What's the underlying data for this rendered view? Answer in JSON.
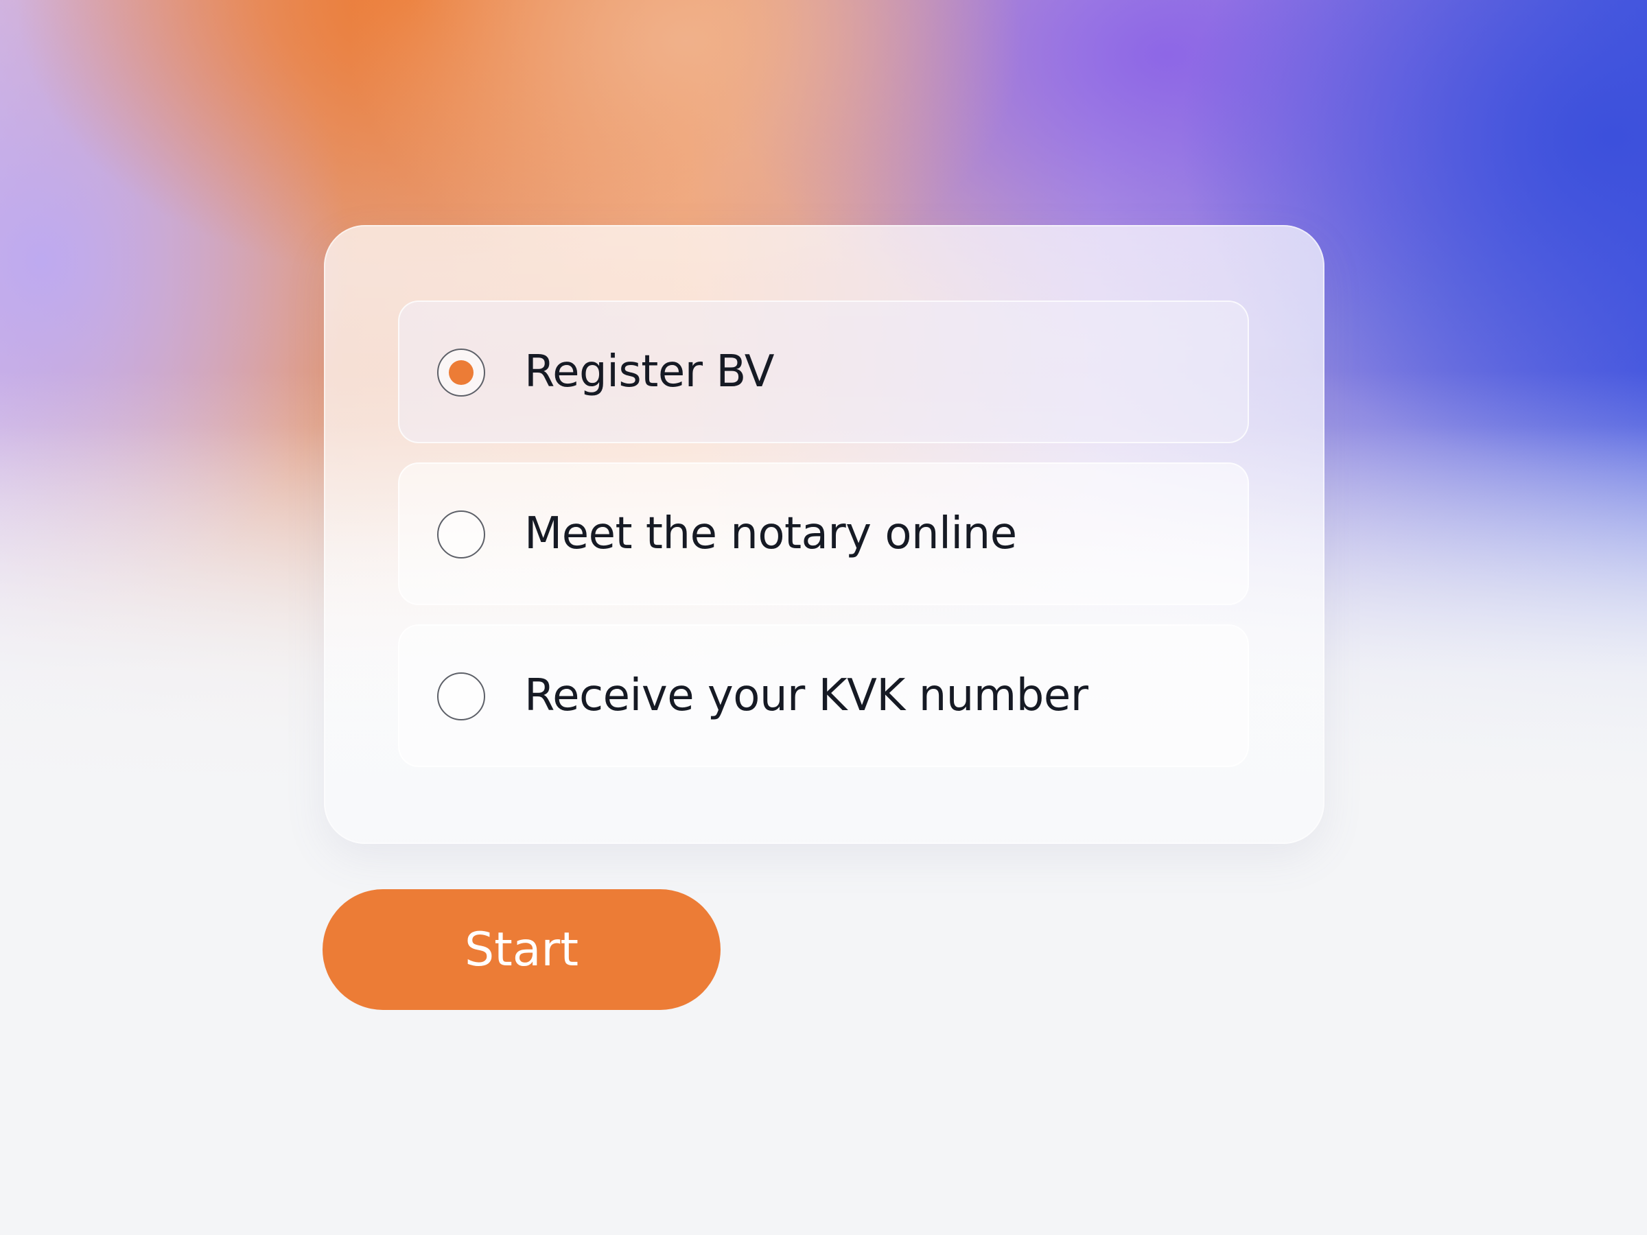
{
  "options": [
    {
      "label": "Register BV",
      "selected": true
    },
    {
      "label": "Meet the notary online",
      "selected": false
    },
    {
      "label": "Receive your KVK number",
      "selected": false
    }
  ],
  "start_button": {
    "label": "Start"
  },
  "colors": {
    "accent": "#ec7c36",
    "text": "#161a24",
    "page_background": "#f4f5f7"
  },
  "icons": {
    "radio_selected": "radio-selected-icon",
    "radio_unselected": "radio-unselected-icon"
  }
}
